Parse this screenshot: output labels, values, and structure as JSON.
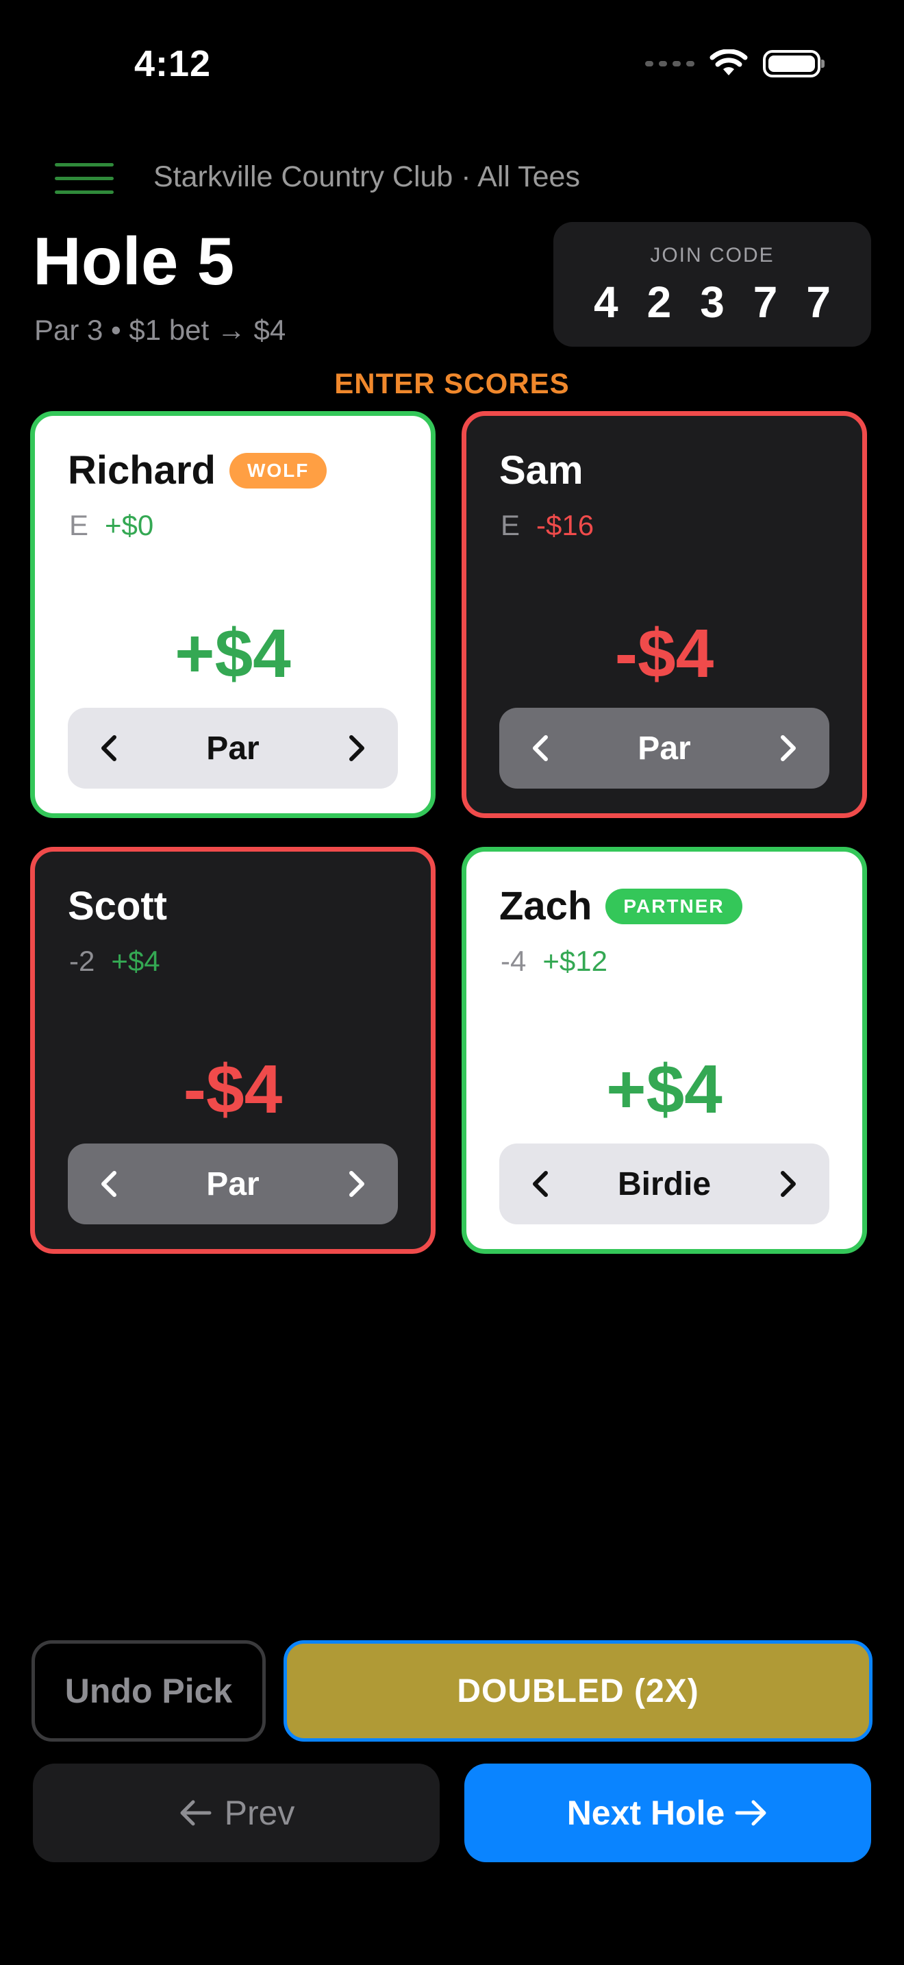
{
  "status_bar": {
    "time": "4:12"
  },
  "header": {
    "course": "Starkville Country Club · All Tees",
    "hole_title": "Hole 5",
    "hole_subtitle": "Par 3 • $1 bet → $4",
    "join_code_label": "JOIN CODE",
    "join_code_digits": [
      "4",
      "2",
      "3",
      "7",
      "7"
    ]
  },
  "section_label": "ENTER SCORES",
  "players": [
    {
      "name": "Richard",
      "badge": "WOLF",
      "score": "E",
      "money": "+$0",
      "hole_amount": "+$4",
      "result": "Par"
    },
    {
      "name": "Sam",
      "badge": "",
      "score": "E",
      "money": "-$16",
      "hole_amount": "-$4",
      "result": "Par"
    },
    {
      "name": "Scott",
      "badge": "",
      "score": "-2",
      "money": "+$4",
      "hole_amount": "-$4",
      "result": "Par"
    },
    {
      "name": "Zach",
      "badge": "PARTNER",
      "score": "-4",
      "money": "+$12",
      "hole_amount": "+$4",
      "result": "Birdie"
    }
  ],
  "actions": {
    "undo_label": "Undo Pick",
    "doubled_label": "DOUBLED (2X)",
    "prev_label": "Prev",
    "next_label": "Next Hole"
  },
  "colors": {
    "win_border": "#34c759",
    "lose_border": "#f04b4b",
    "accent_orange": "#f0882c",
    "primary_blue": "#0a84ff",
    "doubled_gold": "#b09a36"
  }
}
